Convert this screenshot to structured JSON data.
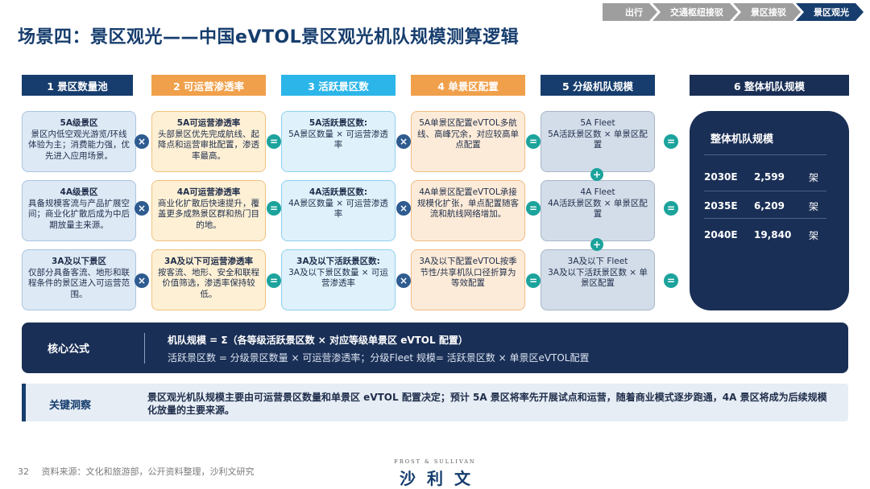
{
  "breadcrumb": [
    "出行",
    "交通枢纽接驳",
    "景区接驳",
    "景区观光"
  ],
  "title": "场景四：景区观光——中国eVTOL景区观光机队规模测算逻辑",
  "columns": [
    {
      "label": "1  景区数量池"
    },
    {
      "label": "2  可运营渗透率"
    },
    {
      "label": "3  活跃景区数"
    },
    {
      "label": "4  单景区配置"
    },
    {
      "label": "5  分级机队规模"
    },
    {
      "label": "6  整体机队规模"
    }
  ],
  "rows": [
    {
      "pool": {
        "title": "5A级景区",
        "desc": "景区内低空观光游览/环线体验为主；消费能力强，优先进入应用场景。"
      },
      "penetration": {
        "title": "5A可运营渗透率",
        "desc": "头部景区优先完成航线、起降点和运营审批配置，渗透率最高。"
      },
      "active": {
        "title": "5A活跃景区数:",
        "desc": "5A景区数量 × 可运营渗透率"
      },
      "config": {
        "desc": "5A单景区配置eVTOL多航线、高峰冗余，对应较高单点配置"
      },
      "fleet": {
        "title": "5A Fleet",
        "desc": "5A活跃景区数 × 单景区配置"
      }
    },
    {
      "pool": {
        "title": "4A级景区",
        "desc": "具备规模客流与产品扩展空间；商业化扩散后成为中后期放量主来源。"
      },
      "penetration": {
        "title": "4A可运营渗透率",
        "desc": "商业化扩散后快速提升，覆盖更多成熟景区群和热门目的地。"
      },
      "active": {
        "title": "4A活跃景区数:",
        "desc": "4A景区数量 × 可运营渗透率"
      },
      "config": {
        "desc": "4A单景区配置eVTOL承接规模化扩张，单点配置随客流和航线网络增加。"
      },
      "fleet": {
        "title": "4A Fleet",
        "desc": "4A活跃景区数 × 单景区配置"
      }
    },
    {
      "pool": {
        "title": "3A及以下景区",
        "desc": "仅部分具备客流、地形和联程条件的景区进入可运营范围。"
      },
      "penetration": {
        "title": "3A及以下可运营渗透率",
        "desc": "按客流、地形、安全和联程价值筛选，渗透率保持较低。"
      },
      "active": {
        "title": "3A及以下活跃景区数:",
        "desc": "3A及以下景区数量 × 可运营渗透率"
      },
      "config": {
        "desc": "3A及以下配置eVTOL按季节性/共享机队口径折算为等效配置"
      },
      "fleet": {
        "title": "3A及以下 Fleet",
        "desc": "3A及以下活跃景区数 × 单景区配置"
      }
    }
  ],
  "operators": {
    "multiply": "×",
    "equals": "=",
    "plus": "+"
  },
  "total": {
    "title": "整体机队规模",
    "rows": [
      {
        "year": "2030E",
        "value": "2,599",
        "unit": "架"
      },
      {
        "year": "2035E",
        "value": "6,209",
        "unit": "架"
      },
      {
        "year": "2040E",
        "value": "19,840",
        "unit": "架"
      }
    ]
  },
  "formula": {
    "label": "核心公式",
    "line1": "机队规模 = Σ（各等级活跃景区数 × 对应等级单景区 eVTOL 配置）",
    "line2": "活跃景区数 = 分级景区数量 × 可运营渗透率；分级Fleet 规模= 活跃景区数 × 单景区eVTOL配置"
  },
  "insight": {
    "label": "关键洞察",
    "text": "景区观光机队规模主要由可运营景区数量和单景区 eVTOL 配置决定；预计 5A 景区将率先开展试点和运营，随着商业模式逐步跑通，4A 景区将成为后续规模化放量的主要来源。"
  },
  "footer": {
    "page": "32",
    "source": "资料来源：文化和旅游部，公开资料整理，沙利文研究"
  },
  "logo": {
    "en": "FROST & SULLIVAN",
    "cn": "沙利文"
  },
  "colors": {
    "navy": "#163d6d",
    "orange": "#f0a04b",
    "cyan": "#2cb5e8",
    "dark": "#1a2f56",
    "teal": "#1ba39c"
  }
}
